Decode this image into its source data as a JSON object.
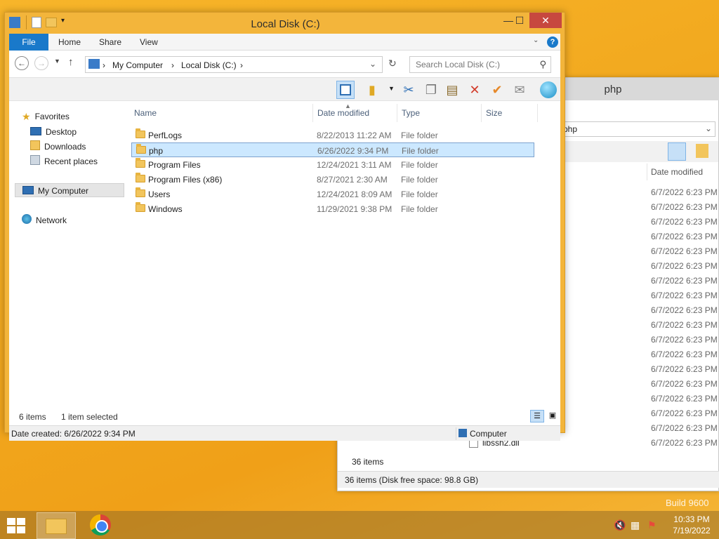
{
  "background_window": {
    "title": "php",
    "breadcrumb_sep": ")",
    "breadcrumb": "php",
    "column_date": "Date modified",
    "dates": [
      "6/7/2022 6:23 PM",
      "6/7/2022 6:23 PM",
      "6/7/2022 6:23 PM",
      "6/7/2022 6:23 PM",
      "6/7/2022 6:23 PM",
      "6/7/2022 6:23 PM",
      "6/7/2022 6:23 PM",
      "6/7/2022 6:23 PM",
      "6/7/2022 6:23 PM",
      "6/7/2022 6:23 PM",
      "6/7/2022 6:23 PM",
      "6/7/2022 6:23 PM",
      "6/7/2022 6:23 PM",
      "6/7/2022 6:23 PM",
      "6/7/2022 6:23 PM",
      "6/7/2022 6:23 PM",
      "6/7/2022 6:23 PM",
      "6/7/2022 6:23 PM"
    ],
    "last_file": {
      "name": "libssh2.dll",
      "date": "6/7/2022 6:23 PM"
    },
    "item_count": "36 items",
    "status": "36 items (Disk free space: 98.8 GB)"
  },
  "window": {
    "title": "Local Disk (C:)",
    "controls": {
      "minimize": "—",
      "maximize": "☐",
      "close": "✕"
    },
    "ribbon_tabs": [
      "File",
      "Home",
      "Share",
      "View"
    ],
    "help": "?",
    "address": {
      "root": "My Computer",
      "current": "Local Disk (C:)",
      "sep": "›"
    },
    "search_placeholder": "Search Local Disk (C:)",
    "nav": {
      "favorites": "Favorites",
      "desktop": "Desktop",
      "downloads": "Downloads",
      "recent": "Recent places",
      "computer": "My Computer",
      "network": "Network"
    },
    "columns": {
      "name": "Name",
      "date": "Date modified",
      "type": "Type",
      "size": "Size"
    },
    "files": [
      {
        "name": "PerfLogs",
        "date": "8/22/2013 11:22 AM",
        "type": "File folder"
      },
      {
        "name": "php",
        "date": "6/26/2022 9:34 PM",
        "type": "File folder"
      },
      {
        "name": "Program Files",
        "date": "12/24/2021 3:11 AM",
        "type": "File folder"
      },
      {
        "name": "Program Files (x86)",
        "date": "8/27/2021 2:30 AM",
        "type": "File folder"
      },
      {
        "name": "Users",
        "date": "12/24/2021 8:09 AM",
        "type": "File folder"
      },
      {
        "name": "Windows",
        "date": "11/29/2021 9:38 PM",
        "type": "File folder"
      }
    ],
    "selected_index": 1,
    "item_count": "6 items",
    "item_selected": "1 item selected",
    "status_left": "Date created: 6/26/2022 9:34 PM",
    "status_right": "Computer"
  },
  "desktop": {
    "build": "Build 9600"
  },
  "taskbar": {
    "time": "10:33 PM",
    "date": "7/19/2022"
  }
}
